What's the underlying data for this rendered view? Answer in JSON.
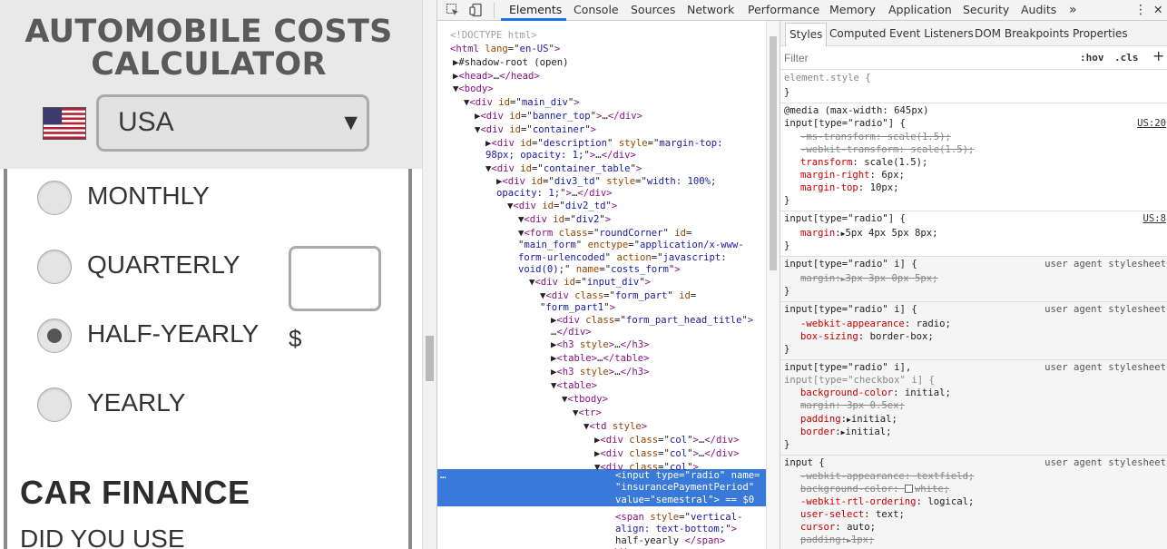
{
  "page": {
    "title_line1": "AUTOMOBILE COSTS",
    "title_line2": "CALCULATOR",
    "country": "USA",
    "caret": "▼",
    "radios": [
      {
        "label": "MONTHLY",
        "checked": false
      },
      {
        "label": "QUARTERLY",
        "checked": false
      },
      {
        "label": "HALF-YEARLY",
        "checked": true
      },
      {
        "label": "YEARLY",
        "checked": false
      }
    ],
    "amount_value": "",
    "currency": "$",
    "section_title": "CAR FINANCE",
    "section_question": "DID YOU USE"
  },
  "toolbar": {
    "inspect_icon": "inspect-element-icon",
    "device_icon": "device-toolbar-icon",
    "tabs": [
      "Elements",
      "Console",
      "Sources",
      "Network",
      "Performance",
      "Memory",
      "Application",
      "Security",
      "Audits"
    ],
    "active_tab": "Elements",
    "more": "»",
    "menu": "⋮",
    "close": "✕"
  },
  "dom_tree": [
    [
      [
        "c",
        "<!DOCTYPE html>"
      ]
    ],
    [
      [
        "tag",
        "<html "
      ],
      [
        "an",
        "lang"
      ],
      [
        "g",
        "=\""
      ],
      [
        "av",
        "en-US"
      ],
      [
        "g",
        "\""
      ],
      [
        "tag",
        ">"
      ]
    ],
    [
      [
        "g",
        "▶#shadow-root (open)"
      ]
    ],
    [
      [
        "g",
        "▶"
      ],
      [
        "tag",
        "<head>"
      ],
      [
        "g",
        "…"
      ],
      [
        "tag",
        "</head>"
      ]
    ],
    [
      [
        "g",
        "▼"
      ],
      [
        "tag",
        "<body>"
      ]
    ],
    [
      [
        "g",
        "▼"
      ],
      [
        "tag",
        "<div "
      ],
      [
        "an",
        "id"
      ],
      [
        "g",
        "=\""
      ],
      [
        "av",
        "main_div"
      ],
      [
        "g",
        "\""
      ],
      [
        "tag",
        ">"
      ]
    ],
    [
      [
        "g",
        "▶"
      ],
      [
        "tag",
        "<div "
      ],
      [
        "an",
        "id"
      ],
      [
        "g",
        "=\""
      ],
      [
        "av",
        "banner_top"
      ],
      [
        "g",
        "\""
      ],
      [
        "tag",
        ">"
      ],
      [
        "g",
        "…"
      ],
      [
        "tag",
        "</div>"
      ]
    ],
    [
      [
        "g",
        "▼"
      ],
      [
        "tag",
        "<div "
      ],
      [
        "an",
        "id"
      ],
      [
        "g",
        "=\""
      ],
      [
        "av",
        "container"
      ],
      [
        "g",
        "\""
      ],
      [
        "tag",
        ">"
      ]
    ],
    [
      [
        "g",
        "▶"
      ],
      [
        "tag",
        "<div "
      ],
      [
        "an",
        "id"
      ],
      [
        "g",
        "=\""
      ],
      [
        "av",
        "description"
      ],
      [
        "g",
        "\" "
      ],
      [
        "an",
        "style"
      ],
      [
        "g",
        "=\""
      ],
      [
        "av",
        "margin-top:"
      ]
    ],
    [
      [
        "av",
        "98px; opacity: 1;"
      ],
      [
        "g",
        "\""
      ],
      [
        "tag",
        ">"
      ],
      [
        "g",
        "…"
      ],
      [
        "tag",
        "</div>"
      ]
    ],
    [
      [
        "g",
        "▼"
      ],
      [
        "tag",
        "<div "
      ],
      [
        "an",
        "id"
      ],
      [
        "g",
        "=\""
      ],
      [
        "av",
        "container_table"
      ],
      [
        "g",
        "\""
      ],
      [
        "tag",
        ">"
      ]
    ],
    [
      [
        "g",
        "▶"
      ],
      [
        "tag",
        "<div "
      ],
      [
        "an",
        "id"
      ],
      [
        "g",
        "=\""
      ],
      [
        "av",
        "div3_td"
      ],
      [
        "g",
        "\" "
      ],
      [
        "an",
        "style"
      ],
      [
        "g",
        "=\""
      ],
      [
        "av",
        "width: 100%;"
      ]
    ],
    [
      [
        "av",
        "opacity: 1;"
      ],
      [
        "g",
        "\""
      ],
      [
        "tag",
        ">"
      ],
      [
        "g",
        "…"
      ],
      [
        "tag",
        "</div>"
      ]
    ],
    [
      [
        "g",
        "▼"
      ],
      [
        "tag",
        "<div "
      ],
      [
        "an",
        "id"
      ],
      [
        "g",
        "=\""
      ],
      [
        "av",
        "div2_td"
      ],
      [
        "g",
        "\""
      ],
      [
        "tag",
        ">"
      ]
    ],
    [
      [
        "g",
        "▼"
      ],
      [
        "tag",
        "<div "
      ],
      [
        "an",
        "id"
      ],
      [
        "g",
        "=\""
      ],
      [
        "av",
        "div2"
      ],
      [
        "g",
        "\""
      ],
      [
        "tag",
        ">"
      ]
    ],
    [
      [
        "g",
        "▼"
      ],
      [
        "tag",
        "<form "
      ],
      [
        "an",
        "class"
      ],
      [
        "g",
        "=\""
      ],
      [
        "av",
        "roundCorner"
      ],
      [
        "g",
        "\" "
      ],
      [
        "an",
        "id"
      ],
      [
        "g",
        "="
      ]
    ],
    [
      [
        "g",
        "\""
      ],
      [
        "av",
        "main_form"
      ],
      [
        "g",
        "\" "
      ],
      [
        "an",
        "enctype"
      ],
      [
        "g",
        "=\""
      ],
      [
        "av",
        "application/x-www-"
      ]
    ],
    [
      [
        "av",
        "form-urlencoded"
      ],
      [
        "g",
        "\" "
      ],
      [
        "an",
        "action"
      ],
      [
        "g",
        "=\""
      ],
      [
        "av",
        "javascript:"
      ]
    ],
    [
      [
        "av",
        "void(0);"
      ],
      [
        "g",
        "\" "
      ],
      [
        "an",
        "name"
      ],
      [
        "g",
        "=\""
      ],
      [
        "av",
        "costs_form"
      ],
      [
        "g",
        "\""
      ],
      [
        "tag",
        ">"
      ]
    ],
    [
      [
        "g",
        "▼"
      ],
      [
        "tag",
        "<div "
      ],
      [
        "an",
        "id"
      ],
      [
        "g",
        "=\""
      ],
      [
        "av",
        "input_div"
      ],
      [
        "g",
        "\""
      ],
      [
        "tag",
        ">"
      ]
    ],
    [
      [
        "g",
        "▼"
      ],
      [
        "tag",
        "<div "
      ],
      [
        "an",
        "class"
      ],
      [
        "g",
        "=\""
      ],
      [
        "av",
        "form_part"
      ],
      [
        "g",
        "\" "
      ],
      [
        "an",
        "id"
      ],
      [
        "g",
        "="
      ]
    ],
    [
      [
        "g",
        "\""
      ],
      [
        "av",
        "form_part1"
      ],
      [
        "g",
        "\""
      ],
      [
        "tag",
        ">"
      ]
    ],
    [
      [
        "g",
        "▶"
      ],
      [
        "tag",
        "<div "
      ],
      [
        "an",
        "class"
      ],
      [
        "g",
        "=\""
      ],
      [
        "av",
        "form_part_head_title"
      ],
      [
        "g",
        "\""
      ],
      [
        "tag",
        ">"
      ]
    ],
    [
      [
        "g",
        "…"
      ],
      [
        "tag",
        "</div>"
      ]
    ],
    [
      [
        "g",
        "▶"
      ],
      [
        "tag",
        "<h3 "
      ],
      [
        "an",
        "style"
      ],
      [
        "tag",
        ">"
      ],
      [
        "g",
        "…"
      ],
      [
        "tag",
        "</h3>"
      ]
    ],
    [
      [
        "g",
        "▶"
      ],
      [
        "tag",
        "<table>"
      ],
      [
        "g",
        "…"
      ],
      [
        "tag",
        "</table>"
      ]
    ],
    [
      [
        "g",
        "▶"
      ],
      [
        "tag",
        "<h3 "
      ],
      [
        "an",
        "style"
      ],
      [
        "tag",
        ">"
      ],
      [
        "g",
        "…"
      ],
      [
        "tag",
        "</h3>"
      ]
    ],
    [
      [
        "g",
        "▼"
      ],
      [
        "tag",
        "<table>"
      ]
    ],
    [
      [
        "g",
        "▼"
      ],
      [
        "tag",
        "<tbody>"
      ]
    ],
    [
      [
        "g",
        "▼"
      ],
      [
        "tag",
        "<tr>"
      ]
    ],
    [
      [
        "g",
        "▼"
      ],
      [
        "tag",
        "<td "
      ],
      [
        "an",
        "style"
      ],
      [
        "tag",
        ">"
      ]
    ],
    [
      [
        "g",
        "▶"
      ],
      [
        "tag",
        "<div "
      ],
      [
        "an",
        "class"
      ],
      [
        "g",
        "=\""
      ],
      [
        "av",
        "col"
      ],
      [
        "g",
        "\""
      ],
      [
        "tag",
        ">"
      ],
      [
        "g",
        "…"
      ],
      [
        "tag",
        "</div>"
      ]
    ],
    [
      [
        "g",
        "▶"
      ],
      [
        "tag",
        "<div "
      ],
      [
        "an",
        "class"
      ],
      [
        "g",
        "=\""
      ],
      [
        "av",
        "col"
      ],
      [
        "g",
        "\""
      ],
      [
        "tag",
        ">"
      ],
      [
        "g",
        "…"
      ],
      [
        "tag",
        "</div>"
      ]
    ],
    [
      [
        "g",
        "▼"
      ],
      [
        "tag",
        "<div "
      ],
      [
        "an",
        "class"
      ],
      [
        "g",
        "=\""
      ],
      [
        "av",
        "col"
      ],
      [
        "g",
        "\""
      ],
      [
        "tag",
        ">"
      ]
    ],
    [
      [
        "tag",
        "<input "
      ],
      [
        "an",
        "type"
      ],
      [
        "g",
        "=\""
      ],
      [
        "av",
        "radio"
      ],
      [
        "g",
        "\" "
      ],
      [
        "an",
        "name"
      ],
      [
        "g",
        "="
      ]
    ],
    [
      [
        "g",
        "\""
      ],
      [
        "av",
        "insurancePaymentPeriod"
      ],
      [
        "g",
        "\""
      ]
    ],
    [
      [
        "an",
        "value"
      ],
      [
        "g",
        "=\""
      ],
      [
        "av",
        "semestral"
      ],
      [
        "g",
        "\""
      ],
      [
        "tag",
        ">"
      ],
      [
        "g",
        " == $0"
      ]
    ],
    [
      [
        "tag",
        "<span "
      ],
      [
        "an",
        "style"
      ],
      [
        "g",
        "=\""
      ],
      [
        "av",
        "vertical-"
      ]
    ],
    [
      [
        "av",
        "align: text-bottom;"
      ],
      [
        "g",
        "\""
      ],
      [
        "tag",
        ">"
      ]
    ],
    [
      [
        "g",
        "half-yearly "
      ],
      [
        "tag",
        "</span>"
      ]
    ],
    [
      [
        "tag",
        "</div>"
      ]
    ]
  ],
  "dom_selected_marker": "…",
  "styles_tabs": [
    "Styles",
    "Computed",
    "Event Listeners",
    "DOM Breakpoints",
    "Properties"
  ],
  "styles_active_tab": "Styles",
  "filter": {
    "placeholder": "Filter",
    "hov": ":hov",
    "cls": ".cls",
    "add": "+"
  },
  "styles_lines": [
    {
      "kind": "dim",
      "text": "element.style {"
    },
    {
      "kind": "plain",
      "text": "}"
    },
    {
      "kind": "plain",
      "text": "@media (max-width: 645px)"
    },
    {
      "kind": "plain",
      "text": "input[type=\"radio\"] {",
      "src": "US:20"
    },
    {
      "kind": "strike",
      "name": "-ms-transform",
      "value": "scale(1.5);"
    },
    {
      "kind": "strike",
      "name": "-webkit-transform",
      "value": "scale(1.5);"
    },
    {
      "kind": "prop",
      "name": "transform",
      "value": "scale(1.5);"
    },
    {
      "kind": "prop",
      "name": "margin-right",
      "value": "6px;"
    },
    {
      "kind": "prop",
      "name": "margin-top",
      "value": "10px;"
    },
    {
      "kind": "plain",
      "text": "}"
    },
    {
      "kind": "plain",
      "text": "input[type=\"radio\"] {",
      "src": "US:8"
    },
    {
      "kind": "prop",
      "name": "margin",
      "value": "5px 4px 5px 8px;",
      "tri": true
    },
    {
      "kind": "plain",
      "text": "}"
    },
    {
      "kind": "plain",
      "text": "input[type=\"radio\" i] {",
      "ua": "user agent stylesheet"
    },
    {
      "kind": "strike",
      "name": "margin",
      "value": "3px 3px 0px 5px;",
      "tri": true
    },
    {
      "kind": "plain",
      "text": "}"
    },
    {
      "kind": "plain",
      "text": "input[type=\"radio\" i] {",
      "ua": "user agent stylesheet"
    },
    {
      "kind": "prop",
      "name": "-webkit-appearance",
      "value": "radio;"
    },
    {
      "kind": "prop",
      "name": "box-sizing",
      "value": "border-box;"
    },
    {
      "kind": "plain",
      "text": "}"
    },
    {
      "kind": "plain",
      "text": "input[type=\"radio\" i],",
      "ua": "user agent stylesheet"
    },
    {
      "kind": "dim",
      "text": "input[type=\"checkbox\" i] {"
    },
    {
      "kind": "prop",
      "name": "background-color",
      "value": "initial;"
    },
    {
      "kind": "strike",
      "name": "margin",
      "value": "3px 0.5ex;"
    },
    {
      "kind": "prop",
      "name": "padding",
      "value": "initial;",
      "tri": true
    },
    {
      "kind": "prop",
      "name": "border",
      "value": "initial;",
      "tri": true
    },
    {
      "kind": "plain",
      "text": "}"
    },
    {
      "kind": "plain",
      "text": "input {",
      "ua": "user agent stylesheet"
    },
    {
      "kind": "strike",
      "name": "-webkit-appearance",
      "value": "textfield;"
    },
    {
      "kind": "strike",
      "name": "background-color",
      "value": "white;",
      "swatch": true
    },
    {
      "kind": "prop",
      "name": "-webkit-rtl-ordering",
      "value": "logical;"
    },
    {
      "kind": "prop",
      "name": "user-select",
      "value": "text;"
    },
    {
      "kind": "prop",
      "name": "cursor",
      "value": "auto;"
    },
    {
      "kind": "strike",
      "name": "padding",
      "value": "1px;",
      "tri": true
    }
  ],
  "colors": {
    "accent": "#1a73e8",
    "selection": "#3879d9",
    "tag": "#881280",
    "attr_name": "#994500",
    "attr_value": "#1a1aa6",
    "css_prop": "#c80000"
  }
}
